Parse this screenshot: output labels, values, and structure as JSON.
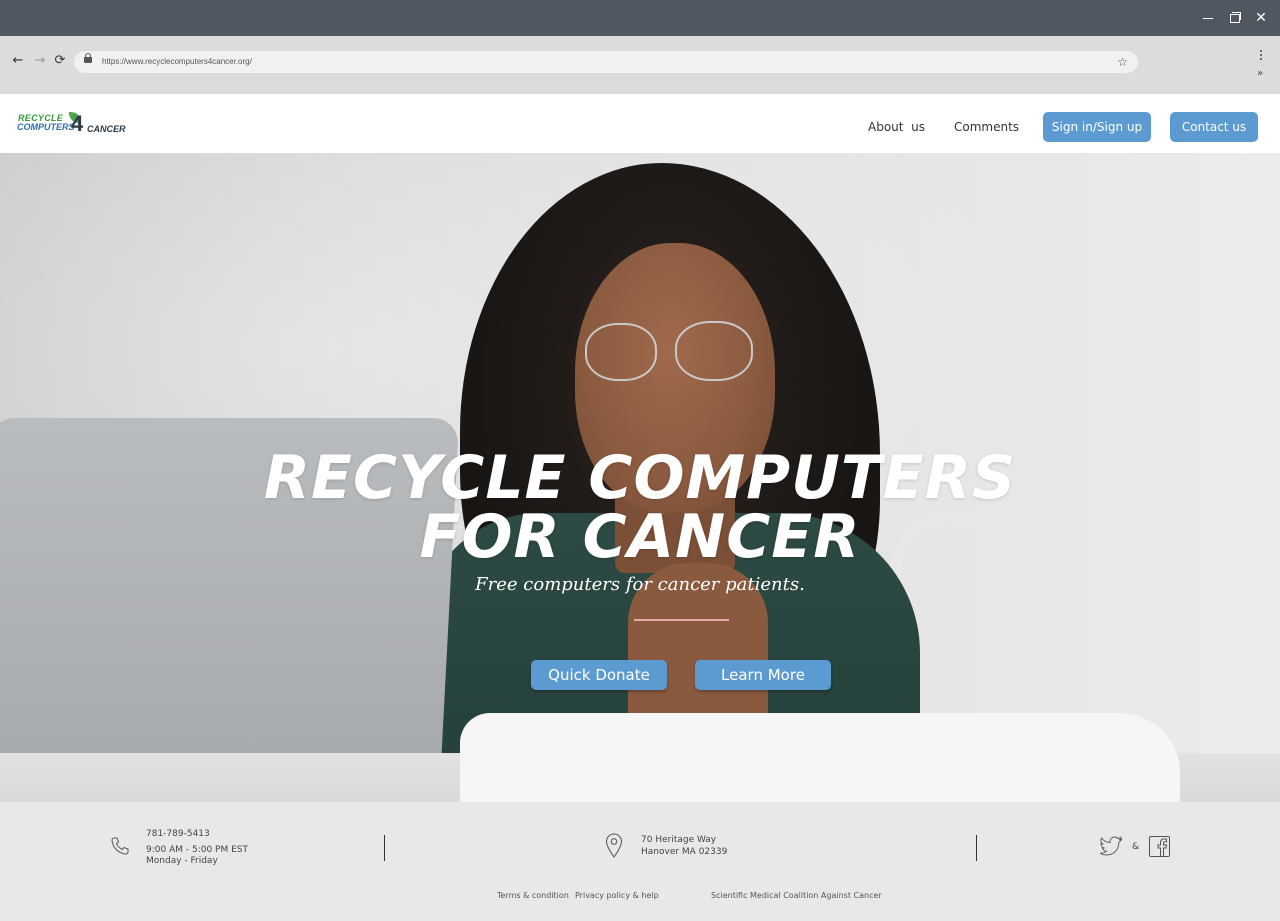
{
  "browser": {
    "url": "https://www.recyclecomputers4cancer.org/",
    "window_controls": {
      "minimize": "minimize-icon",
      "restore": "restore-icon",
      "close": "close-icon"
    }
  },
  "header": {
    "logo": {
      "line1": "RECYCLE",
      "line2": "COMPUTERS",
      "four": "4",
      "line3": "CANCER"
    },
    "nav": {
      "about": "About  us",
      "comments": "Comments",
      "signin": "Sign in/Sign up",
      "contact": "Contact us"
    },
    "accent_color": "#5b9bd1"
  },
  "hero": {
    "title_line1": "RECYCLE COMPUTERS",
    "title_line2": "FOR CANCER",
    "subtitle": "Free computers for cancer patients.",
    "buttons": {
      "donate": "Quick Donate",
      "learn": "Learn More"
    }
  },
  "footer": {
    "phone": "781-789-5413",
    "hours": "9:00 AM - 5:00 PM EST",
    "days": "Monday - Friday",
    "address_line1": "70 Heritage Way",
    "address_line2": "Hanover MA 02339",
    "social_separator": "&",
    "links": {
      "terms": "Terms & condition",
      "privacy": "Privacy policy & help",
      "coalition": "Scientific Medical Coalition Against Cancer"
    }
  }
}
